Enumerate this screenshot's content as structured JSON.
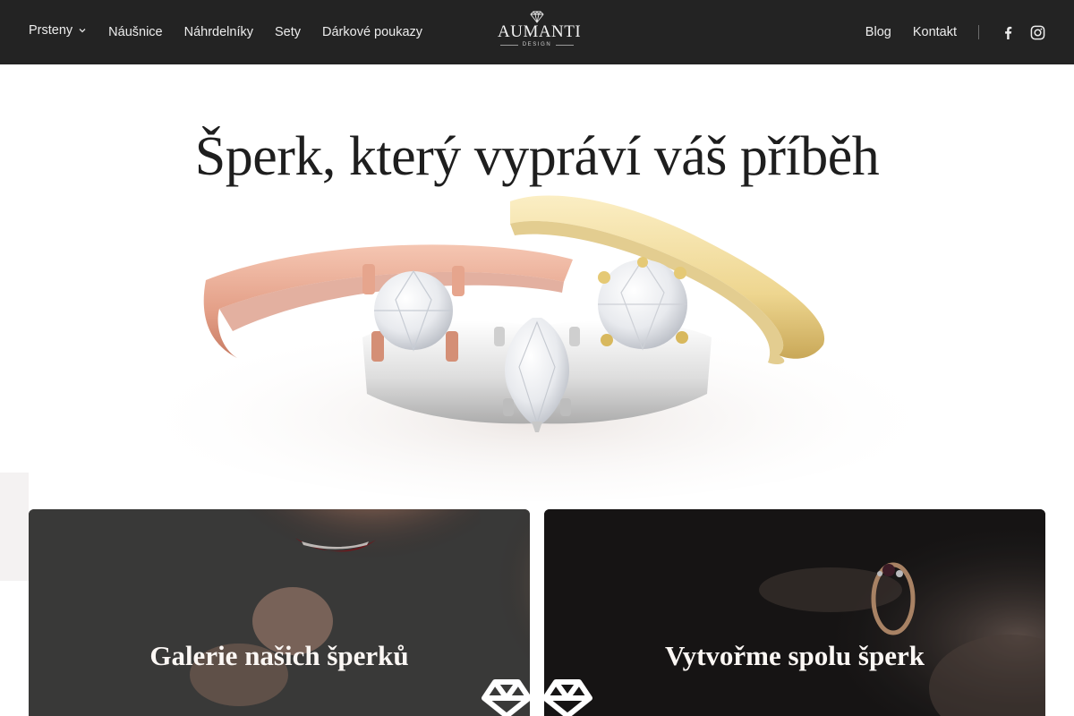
{
  "header": {
    "nav_left": [
      {
        "label": "Prsteny",
        "has_dropdown": true
      },
      {
        "label": "Náušnice"
      },
      {
        "label": "Náhrdelníky"
      },
      {
        "label": "Sety"
      },
      {
        "label": "Dárkové poukazy"
      }
    ],
    "logo": {
      "brand": "AUMANTI",
      "subtitle": "DESIGN"
    },
    "nav_right": [
      {
        "label": "Blog"
      },
      {
        "label": "Kontakt"
      }
    ],
    "social": [
      "facebook-icon",
      "instagram-icon"
    ]
  },
  "hero": {
    "title": "Šperk, který vypráví váš příběh"
  },
  "cards": [
    {
      "title": "Galerie našich šperků"
    },
    {
      "title": "Vytvořme spolu šperk"
    }
  ],
  "colors": {
    "header_bg": "#232323",
    "header_text": "#ededed",
    "page_bg": "#ffffff",
    "rose_gold": "#e7a78f",
    "yellow_gold": "#eed690",
    "white_gold": "#d9d9d9"
  }
}
